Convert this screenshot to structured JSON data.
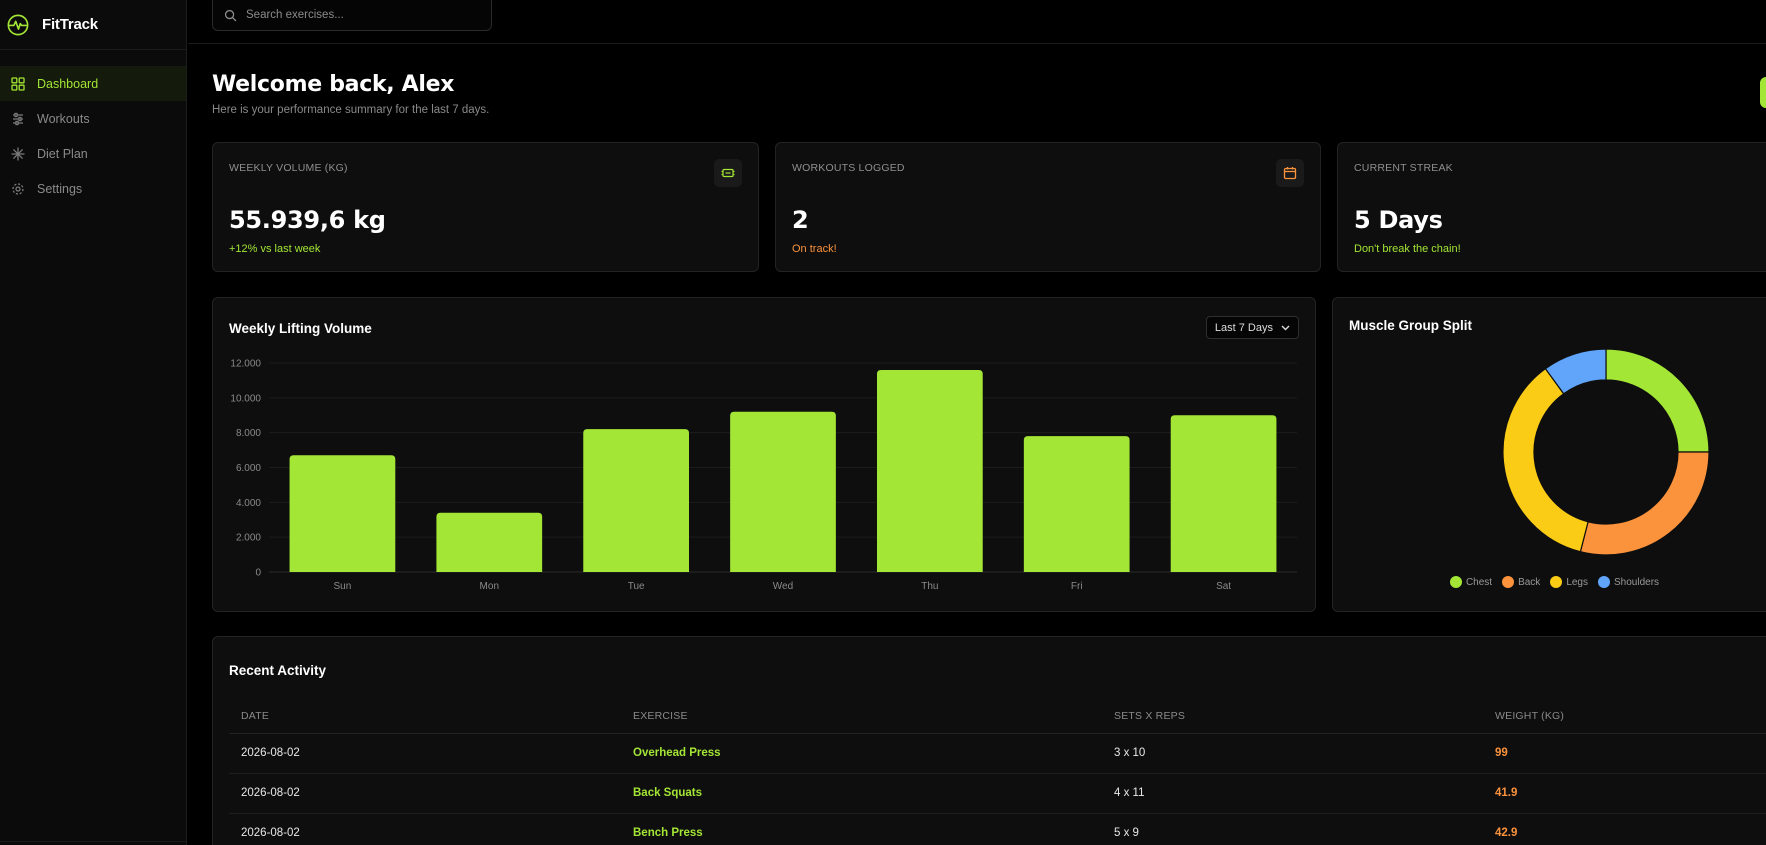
{
  "brand": {
    "name": "FitTrack"
  },
  "nav": [
    {
      "label": "Dashboard",
      "icon": "grid-icon",
      "active": true
    },
    {
      "label": "Workouts",
      "icon": "sliders-icon",
      "active": false
    },
    {
      "label": "Diet Plan",
      "icon": "asterisk-icon",
      "active": false
    },
    {
      "label": "Settings",
      "icon": "gear-icon",
      "active": false
    }
  ],
  "search": {
    "placeholder": "Search exercises..."
  },
  "header": {
    "title": "Welcome back, Alex",
    "subtitle": "Here is your performance summary for the last 7 days."
  },
  "stats": [
    {
      "label": "WEEKLY VOLUME (KG)",
      "value": "55.939,6 kg",
      "note": "+12% vs last week",
      "note_color": "#a3e635",
      "icon": "dumbbell-icon",
      "icon_color": "#a3e635"
    },
    {
      "label": "WORKOUTS LOGGED",
      "value": "2",
      "note": "On track!",
      "note_color": "#fb923c",
      "icon": "calendar-icon",
      "icon_color": "#fb923c"
    },
    {
      "label": "CURRENT STREAK",
      "value": "5 Days",
      "note": "Don't break the chain!",
      "note_color": "#a3e635"
    }
  ],
  "volume_panel": {
    "title": "Weekly Lifting Volume",
    "range_label": "Last 7 Days"
  },
  "split_panel": {
    "title": "Muscle Group Split"
  },
  "chart_data": [
    {
      "type": "bar",
      "categories": [
        "Sun",
        "Mon",
        "Tue",
        "Wed",
        "Thu",
        "Fri",
        "Sat"
      ],
      "values": [
        6700,
        3400,
        8200,
        9200,
        11600,
        7800,
        9000
      ],
      "ylim": [
        0,
        12000
      ],
      "yticks": [
        "0",
        "2.000",
        "4.000",
        "6.000",
        "8.000",
        "10.000",
        "12.000"
      ],
      "ytick_values": [
        0,
        2000,
        4000,
        6000,
        8000,
        10000,
        12000
      ],
      "color": "#a3e635",
      "grid": true
    },
    {
      "type": "pie",
      "donut": true,
      "labels": [
        "Chest",
        "Back",
        "Legs",
        "Shoulders"
      ],
      "values": [
        25,
        29,
        36,
        10
      ],
      "colors": [
        "#a3e635",
        "#fb923c",
        "#facc15",
        "#60a5fa"
      ],
      "legend": "bottom"
    }
  ],
  "activity": {
    "title": "Recent Activity",
    "columns": [
      "DATE",
      "EXERCISE",
      "SETS X REPS",
      "WEIGHT (KG)"
    ],
    "rows": [
      {
        "date": "2026-08-02",
        "exercise": "Overhead Press",
        "sets": "3 x 10",
        "weight": "99"
      },
      {
        "date": "2026-08-02",
        "exercise": "Back Squats",
        "sets": "4 x 11",
        "weight": "41.9"
      },
      {
        "date": "2026-08-02",
        "exercise": "Bench Press",
        "sets": "5 x 9",
        "weight": "42.9"
      }
    ]
  }
}
